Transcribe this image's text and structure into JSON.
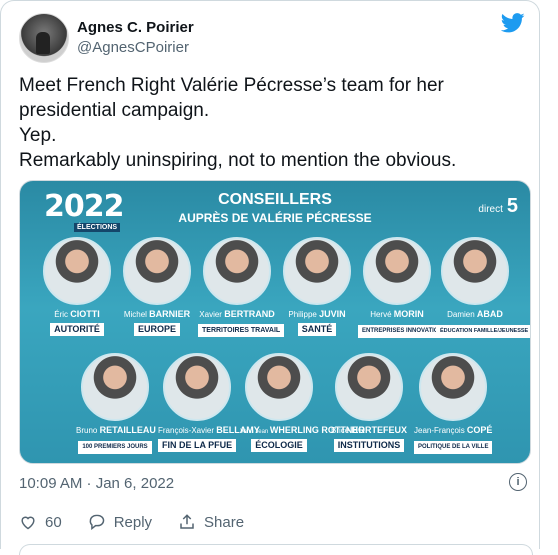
{
  "user": {
    "display_name": "Agnes C. Poirier",
    "handle": "@AgnesCPoirier"
  },
  "tweet_lines": [
    "Meet French Right Valérie Pécresse’s team for her",
    "presidential campaign.",
    "Yep.",
    "Remarkably uninspiring, not to mention the obvious."
  ],
  "media": {
    "logo_year": "2022",
    "logo_sub": "ÉLECTIONS",
    "title": "CONSEILLERS",
    "subtitle": "AUPRÈS DE VALÉRIE PÉCRESSE",
    "channel_prefix": "direct",
    "channel_num": "5",
    "row1": [
      {
        "first": "Éric",
        "last": "CIOTTI",
        "role": "AUTORITÉ"
      },
      {
        "first": "Michel",
        "last": "BARNIER",
        "role": "EUROPE"
      },
      {
        "first": "Xavier",
        "last": "BERTRAND",
        "role": "TERRITOIRES TRAVAIL"
      },
      {
        "first": "Philippe",
        "last": "JUVIN",
        "role": "SANTÉ"
      },
      {
        "first": "Hervé",
        "last": "MORIN",
        "role": "ENTREPRISES INNOVATION"
      },
      {
        "first": "Damien",
        "last": "ABAD",
        "role": "ÉDUCATION FAMILLE/JEUNESSE"
      }
    ],
    "row2": [
      {
        "first": "Bruno",
        "last": "RETAILLEAU",
        "role": "100 PREMIERS JOURS"
      },
      {
        "first": "François-Xavier",
        "last": "BELLAMY",
        "role": "FIN DE LA PFUE"
      },
      {
        "first": "Yann Jean",
        "last": "WHERLING ROTTNER",
        "role": "ÉCOLOGIE"
      },
      {
        "first": "Brice",
        "last": "HORTEFEUX",
        "role": "INSTITUTIONS"
      },
      {
        "first": "Jean-François",
        "last": "COPÉ",
        "role": "POLITIQUE DE LA VILLE"
      }
    ]
  },
  "timestamp": "10:09 AM · Jan 6, 2022",
  "actions": {
    "likes": "60",
    "reply_label": "Reply",
    "share_label": "Share"
  },
  "colors": {
    "twitter_blue": "#1d9bf0",
    "meta_gray": "#536471"
  }
}
